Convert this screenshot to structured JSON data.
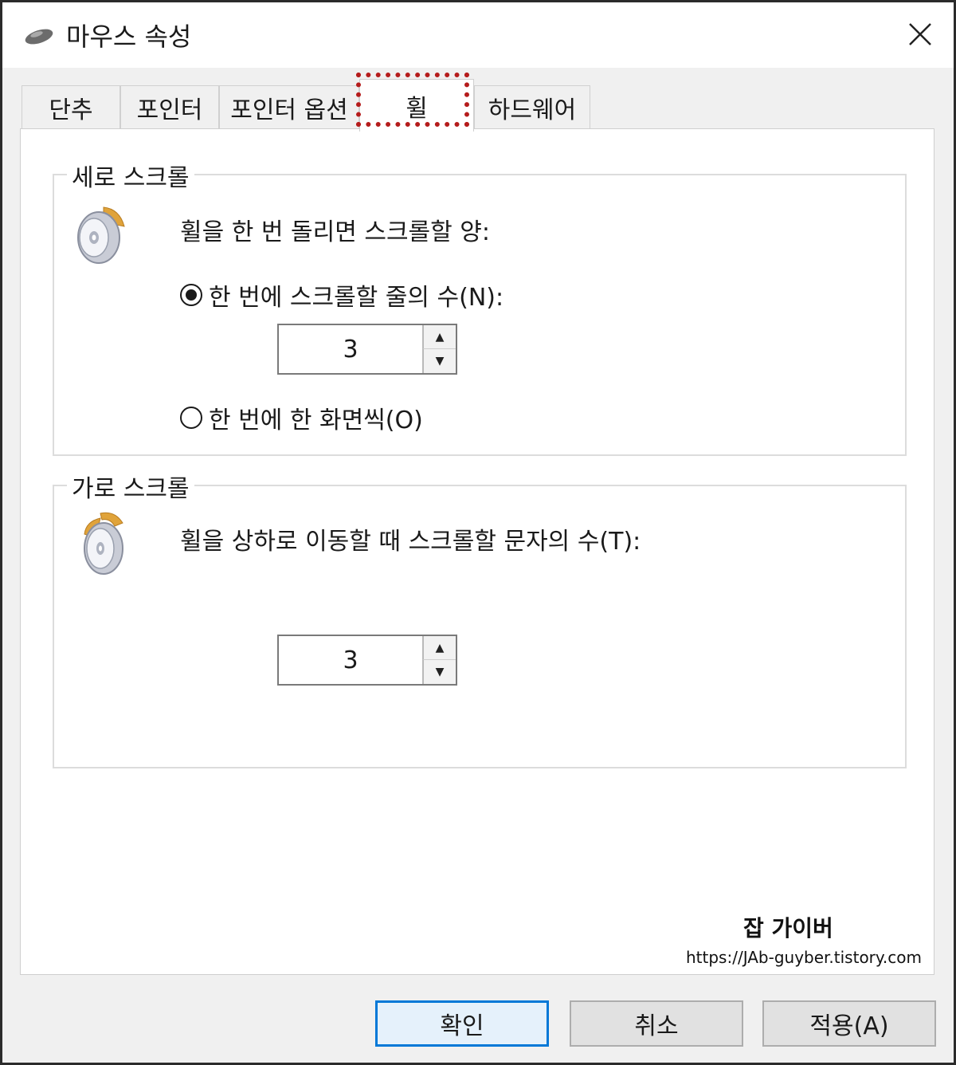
{
  "window": {
    "title": "마우스 속성"
  },
  "tabs": [
    {
      "label": "단추"
    },
    {
      "label": "포인터"
    },
    {
      "label": "포인터 옵션"
    },
    {
      "label": "휠"
    },
    {
      "label": "하드웨어"
    }
  ],
  "vertical_scroll": {
    "group_title": "세로 스크롤",
    "description": "휠을 한 번 돌리면 스크롤할 양:",
    "option_lines_label": "한 번에 스크롤할 줄의 수(N):",
    "lines_value": "3",
    "option_screen_label": "한 번에 한 화면씩(O)"
  },
  "horizontal_scroll": {
    "group_title": "가로 스크롤",
    "description": "휠을 상하로 이동할 때 스크롤할 문자의 수(T):",
    "chars_value": "3"
  },
  "watermark": {
    "title": "잡 가이버",
    "url": "https://JAb-guyber.tistory.com"
  },
  "buttons": {
    "ok": "확인",
    "cancel": "취소",
    "apply": "적용(A)"
  },
  "icons": {
    "app": "mouse-icon",
    "wheel": "mouse-wheel-icon",
    "close": "close-icon"
  },
  "colors": {
    "highlight": "#b51c1c",
    "default_button_border": "#0078d7"
  }
}
